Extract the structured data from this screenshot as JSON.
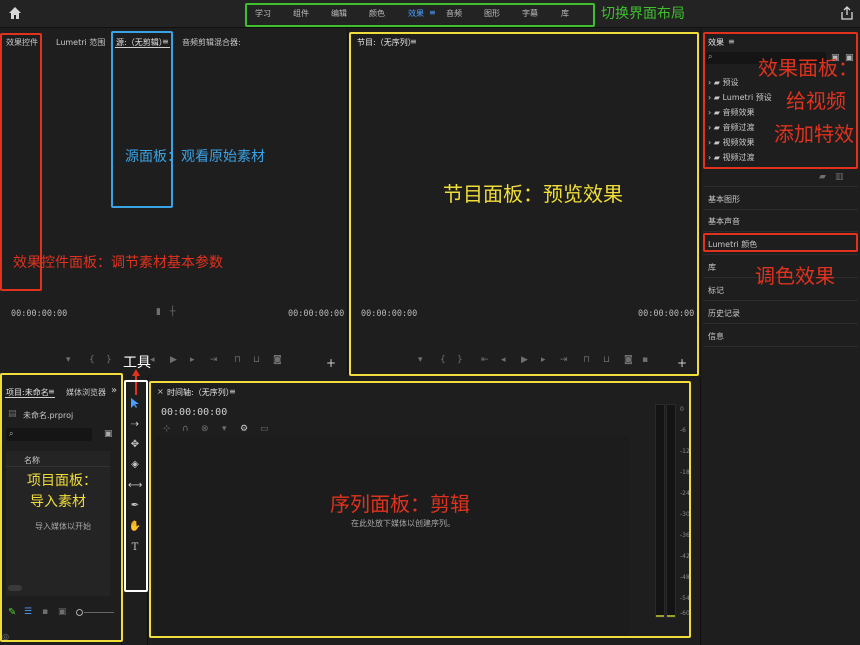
{
  "workspace_tabs": [
    "学习",
    "组件",
    "编辑",
    "颜色",
    "效果",
    "音频",
    "图形",
    "字幕",
    "库"
  ],
  "active_workspace_index": 4,
  "source_tabs": {
    "effect_controls": "效果控件",
    "lumetri_scope": "Lumetri 范围",
    "source": "源:（无剪辑）",
    "audio_mixer": "音频剪辑混合器:"
  },
  "program_title": "节目:（无序列）",
  "timecodes": {
    "source_left": "00:00:00:00",
    "source_right": "00:00:00:00",
    "program_left": "00:00:00:00",
    "program_right": "00:00:00:00",
    "timeline": "00:00:00:00"
  },
  "project": {
    "tab_label": "项目:未命名",
    "media_browser_tab": "媒体浏览器",
    "file_name": "未命名.prproj",
    "column_name": "名称",
    "empty_hint": "导入媒体以开始"
  },
  "timeline": {
    "tab_label": "时间轴:（无序列）",
    "empty_hint": "在此处放下媒体以创建序列。"
  },
  "effects_panel": {
    "title": "效果",
    "items": [
      "预设",
      "Lumetri 预设",
      "音频效果",
      "音频过渡",
      "视频效果",
      "视频过渡"
    ]
  },
  "right_panels": [
    "基本图形",
    "基本声音",
    "Lumetri 颜色",
    "库",
    "标记",
    "历史记录",
    "信息"
  ],
  "meter_ticks": [
    "0",
    "-6",
    "-12",
    "-18",
    "-24",
    "-30",
    "-36",
    "-42",
    "-48",
    "-54",
    "-60"
  ],
  "annotations": {
    "workspace": "切换界面布局",
    "source_panel": "源面板：观看原始素材",
    "effect_controls": "效果控件面板：调节素材基本参数",
    "program_panel": "节目面板：预览效果",
    "effects_line1": "效果面板：",
    "effects_line2": "给视频",
    "effects_line3": "添加特效",
    "lumetri": "调色效果",
    "tools": "工具",
    "project_line1": "项目面板：",
    "project_line2": "导入素材",
    "sequence_panel": "序列面板：剪辑"
  },
  "colors": {
    "green": "#3fbf2f",
    "blue": "#3aa3e6",
    "red": "#e0321e",
    "yellow": "#f0dd3a",
    "white": "#ffffff",
    "accent": "#4a9fff"
  }
}
